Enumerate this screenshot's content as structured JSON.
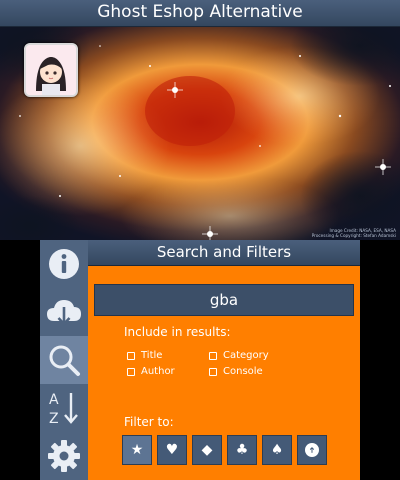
{
  "app": {
    "title": "Ghost Eshop Alternative"
  },
  "top_screen": {
    "credit_lines": [
      "Image Credit: NASA, ESA, NASA",
      "Processing & Copyright: Stefan Adamski"
    ]
  },
  "sidebar": {
    "items": [
      {
        "icon": "info-icon",
        "active": false
      },
      {
        "icon": "cloud-download-icon",
        "active": false
      },
      {
        "icon": "search-icon",
        "active": true
      },
      {
        "icon": "sort-az-icon",
        "active": false
      },
      {
        "icon": "gear-icon",
        "active": false
      }
    ]
  },
  "search_panel": {
    "header": "Search and Filters",
    "query": "gba",
    "include_label": "Include in results:",
    "include_options": [
      {
        "label": "Title",
        "checked": false
      },
      {
        "label": "Category",
        "checked": false
      },
      {
        "label": "Author",
        "checked": false
      },
      {
        "label": "Console",
        "checked": false
      }
    ],
    "filter_label": "Filter to:",
    "filters": [
      {
        "symbol": "★",
        "icon": "star-icon",
        "selected": true
      },
      {
        "symbol": "♥",
        "icon": "heart-icon",
        "selected": false
      },
      {
        "symbol": "◆",
        "icon": "diamond-icon",
        "selected": false
      },
      {
        "symbol": "♣",
        "icon": "club-icon",
        "selected": false
      },
      {
        "symbol": "♠",
        "icon": "spade-icon",
        "selected": false
      },
      {
        "symbol": "➜",
        "icon": "arrow-circle-icon",
        "selected": false
      }
    ]
  },
  "colors": {
    "accent": "#ff7f00",
    "sidebar": "#4f6480",
    "sidebar_active": "#6f84a1",
    "header": "#3f536e"
  }
}
